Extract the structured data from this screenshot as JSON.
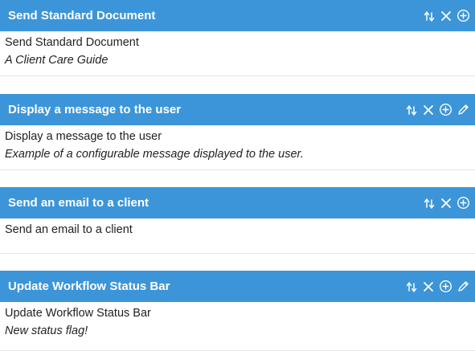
{
  "accent_color": "#3c95d9",
  "actions": [
    {
      "name": "move",
      "icon": "move-arrows-icon"
    },
    {
      "name": "delete",
      "icon": "close-icon"
    },
    {
      "name": "add",
      "icon": "plus-circle-icon"
    },
    {
      "name": "edit",
      "icon": "pencil-icon"
    }
  ],
  "cards": [
    {
      "title": "Send Standard Document",
      "name": "Send Standard Document",
      "description": "A Client Care Guide",
      "has_edit": false
    },
    {
      "title": "Display a message to the user",
      "name": "Display a message to the user",
      "description": "Example of a configurable message displayed to the user.",
      "has_edit": true
    },
    {
      "title": "Send an email to a client",
      "name": "Send an email to a client",
      "description": "",
      "has_edit": false
    },
    {
      "title": "Update Workflow Status Bar",
      "name": "Update Workflow Status Bar",
      "description": "New status flag!",
      "has_edit": true
    }
  ]
}
